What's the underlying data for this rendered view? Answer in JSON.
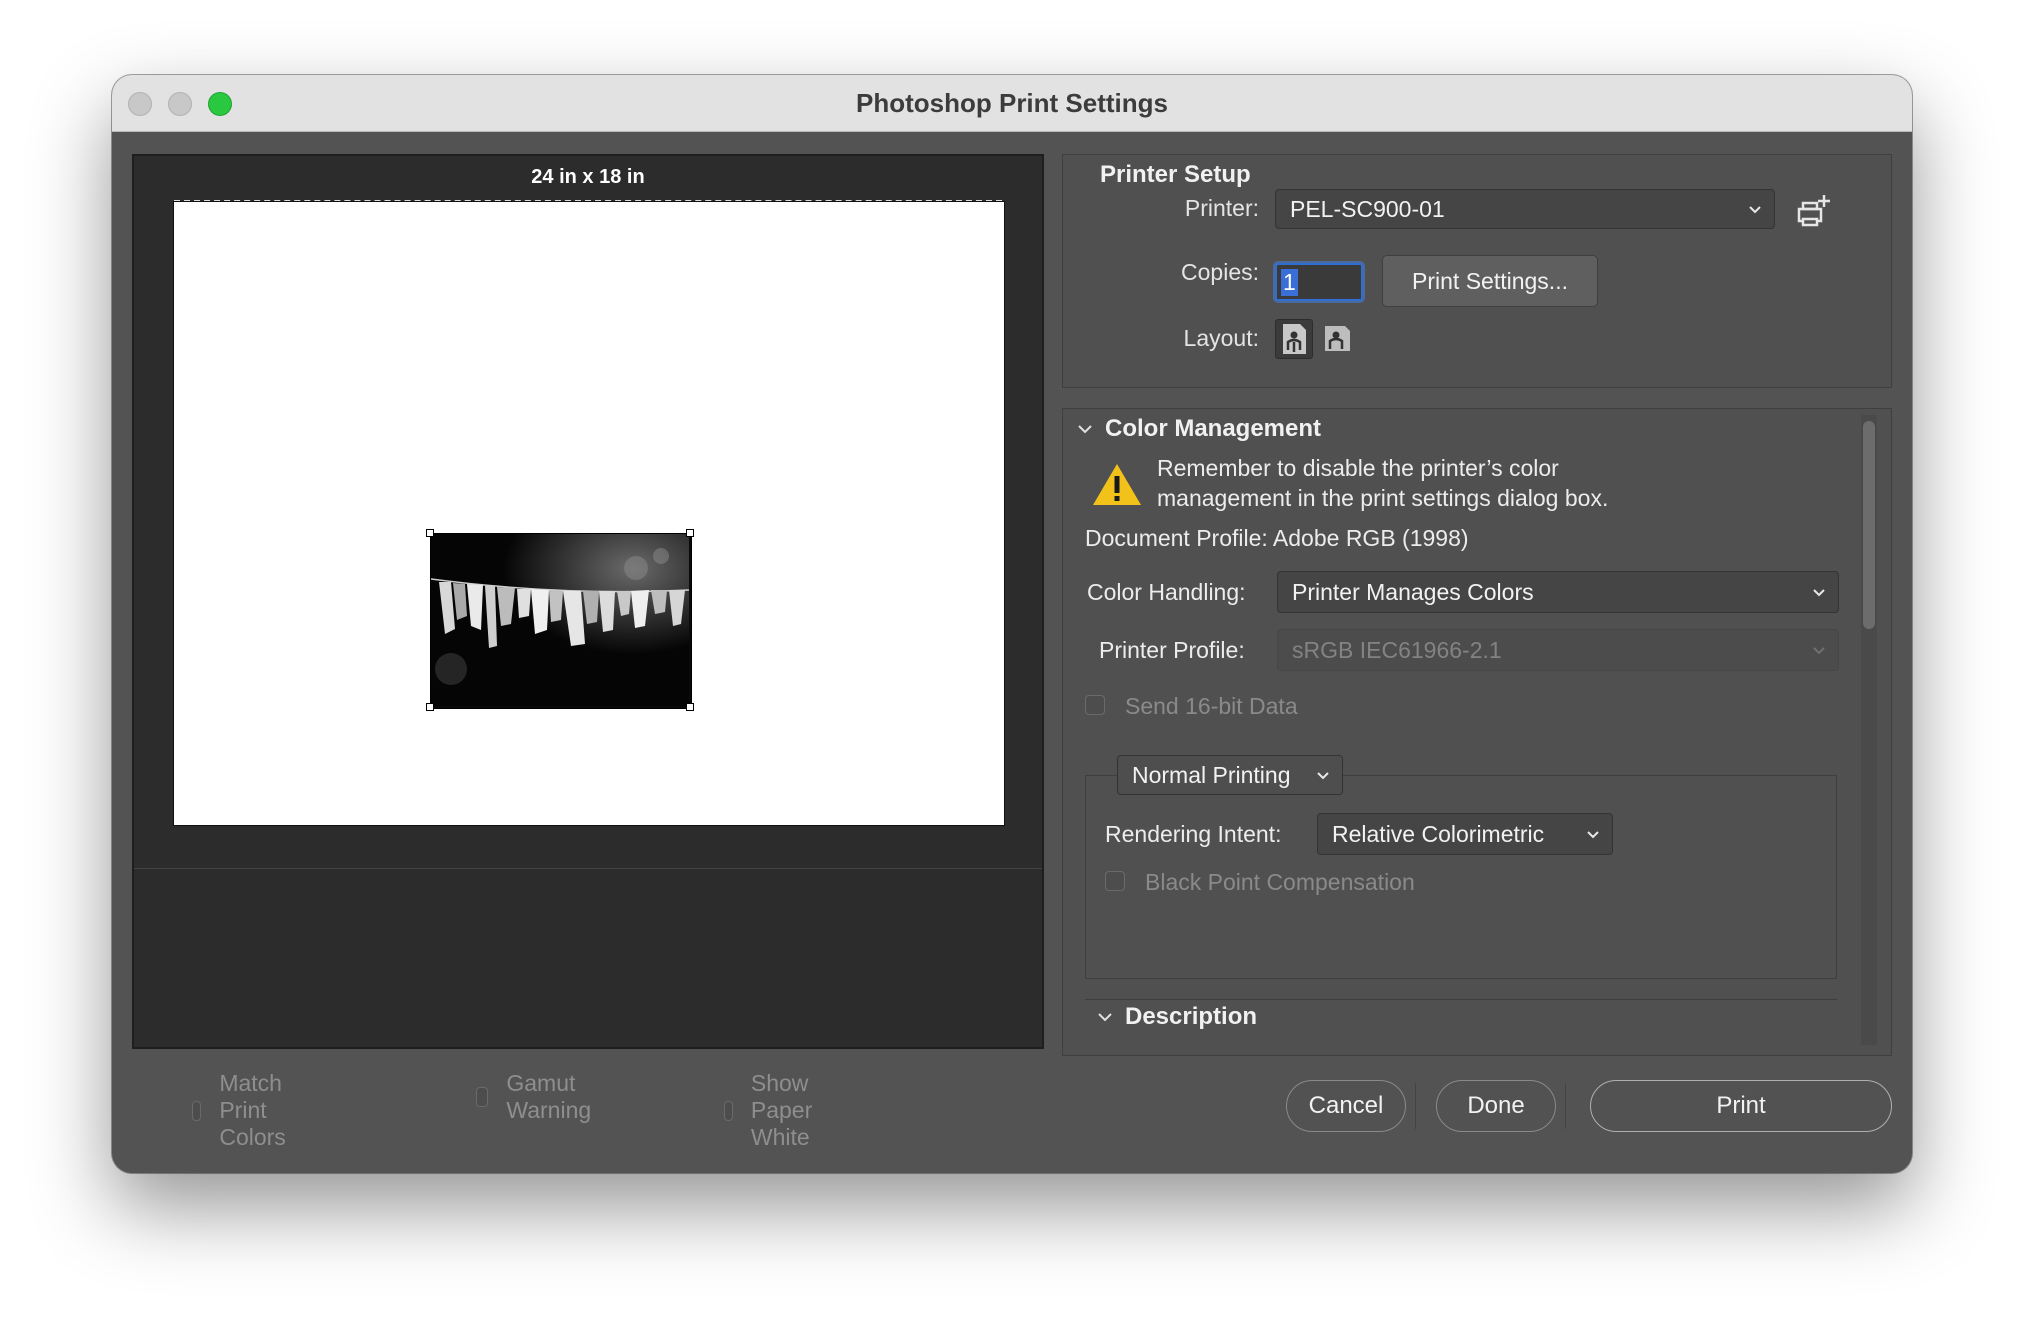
{
  "window": {
    "title": "Photoshop Print Settings"
  },
  "preview": {
    "paper_size": "24 in x 18 in"
  },
  "bottom_checkboxes": [
    {
      "label": "Match Print Colors",
      "checked": false
    },
    {
      "label": "Gamut Warning",
      "checked": false
    },
    {
      "label": "Show Paper White",
      "checked": false
    }
  ],
  "printer_setup": {
    "title": "Printer Setup",
    "printer_label": "Printer:",
    "printer_value": "PEL-SC900-01",
    "copies_label": "Copies:",
    "copies_value": "1",
    "print_settings_button": "Print Settings...",
    "layout_label": "Layout:"
  },
  "color_management": {
    "title": "Color Management",
    "warning_line1": "Remember to disable the printer’s color",
    "warning_line2": "management in the print settings dialog box.",
    "document_profile": "Document Profile: Adobe RGB (1998)",
    "color_handling_label": "Color Handling:",
    "color_handling_value": "Printer Manages Colors",
    "printer_profile_label": "Printer Profile:",
    "printer_profile_value": "sRGB IEC61966-2.1",
    "send_16bit_label": "Send 16-bit Data",
    "printing_mode": "Normal Printing",
    "rendering_intent_label": "Rendering Intent:",
    "rendering_intent_value": "Relative Colorimetric",
    "black_point_label": "Black Point Compensation"
  },
  "description": {
    "title": "Description"
  },
  "buttons": {
    "cancel": "Cancel",
    "done": "Done",
    "print": "Print"
  }
}
